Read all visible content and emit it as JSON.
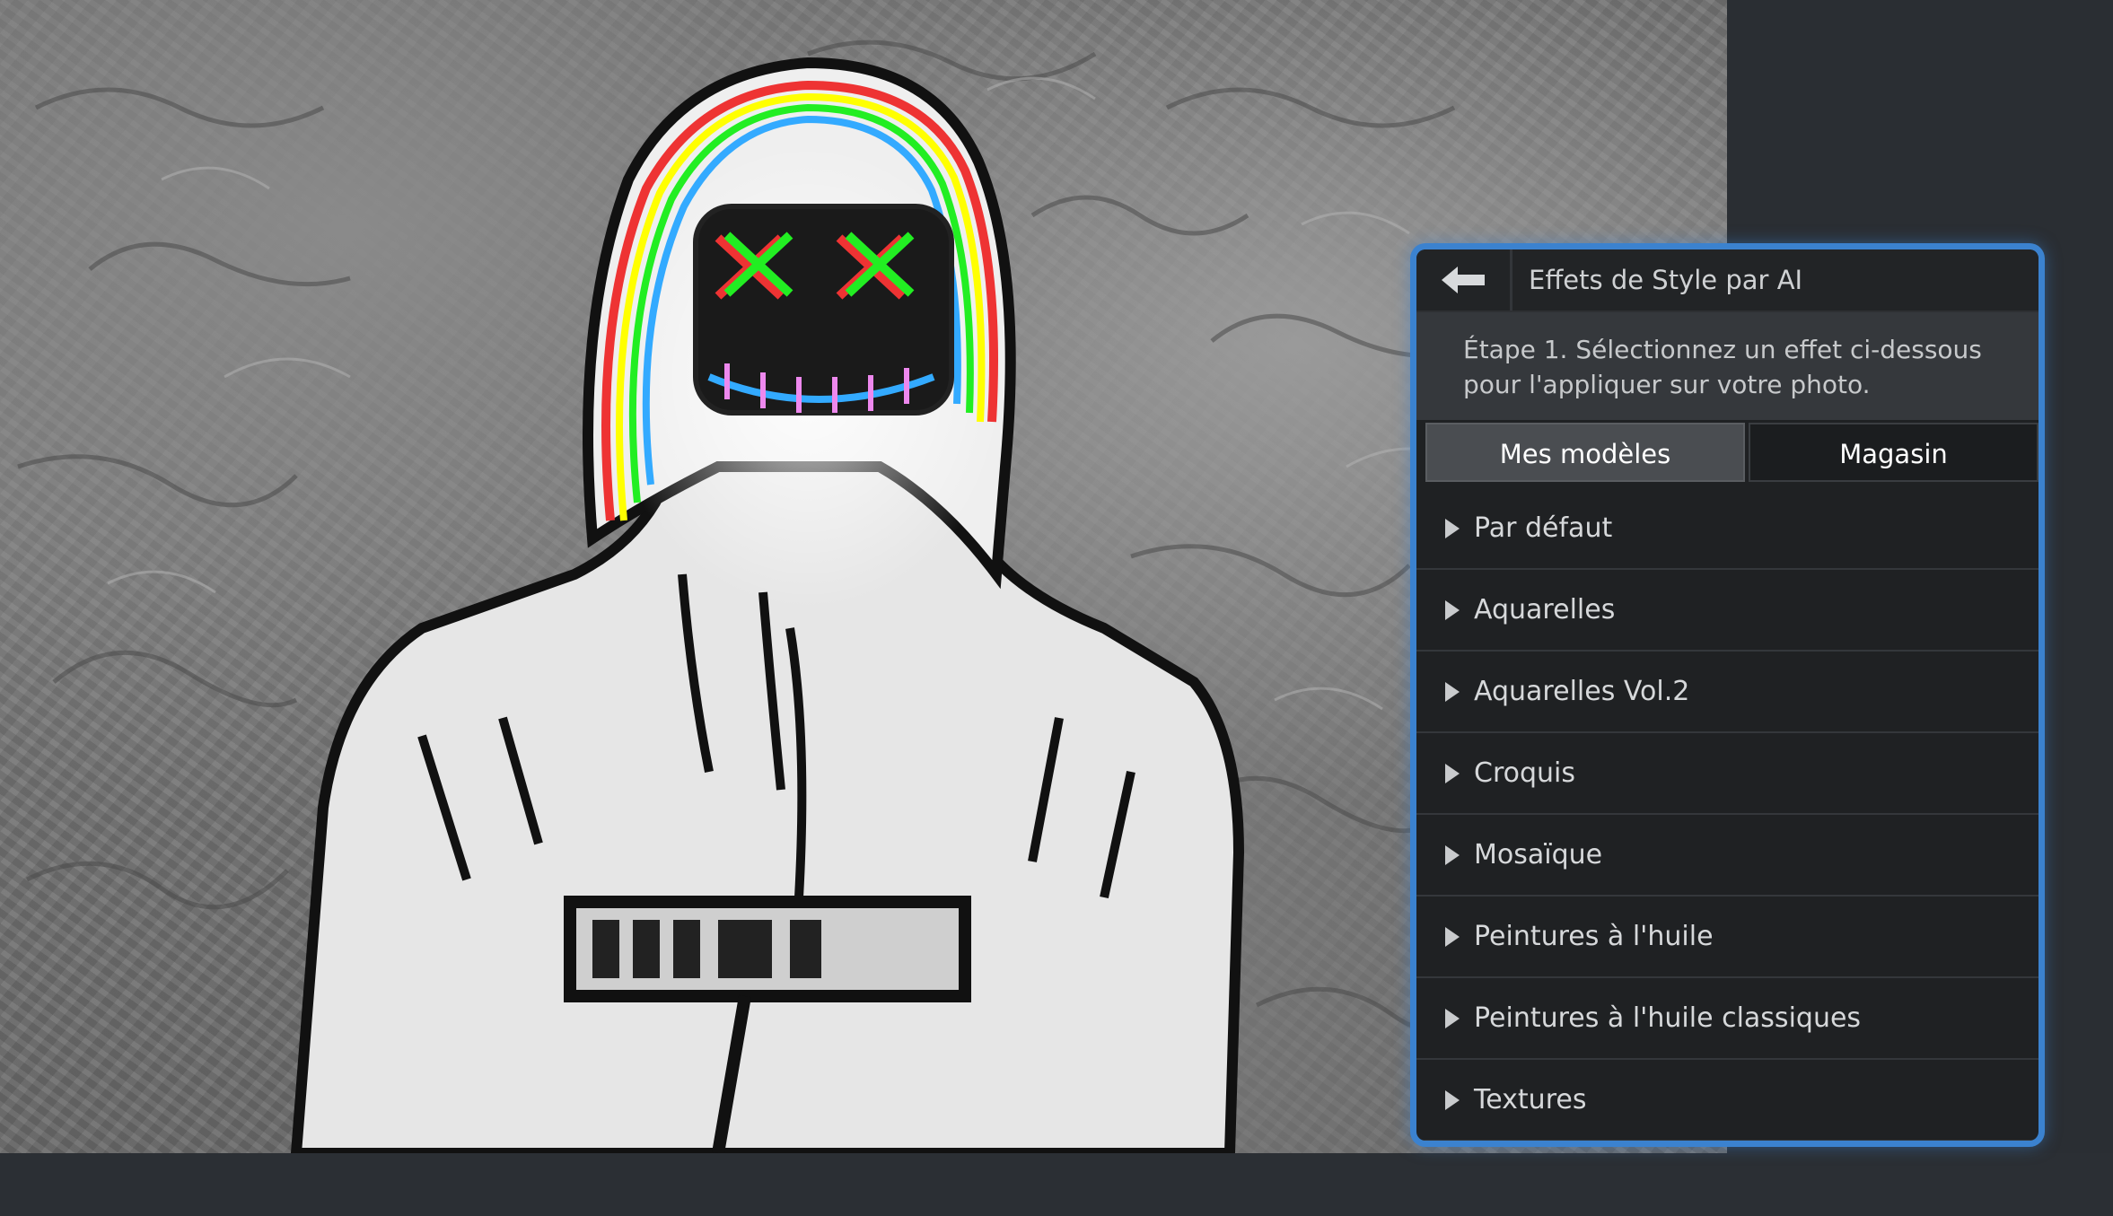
{
  "panel": {
    "back_icon": "back-arrow-icon",
    "title": "Effets de Style par AI",
    "step_text": "Étape 1. Sélectionnez un effet ci-dessous pour l'appliquer sur votre photo.",
    "tabs": [
      {
        "label": "Mes modèles",
        "active": true
      },
      {
        "label": "Magasin",
        "active": false
      }
    ],
    "categories": [
      {
        "label": "Par défaut"
      },
      {
        "label": "Aquarelles"
      },
      {
        "label": "Aquarelles Vol.2"
      },
      {
        "label": "Croquis"
      },
      {
        "label": "Mosaïque"
      },
      {
        "label": "Peintures à l'huile"
      },
      {
        "label": "Peintures à l'huile classiques"
      },
      {
        "label": "Textures"
      }
    ],
    "accent_color": "#3b82cf"
  }
}
